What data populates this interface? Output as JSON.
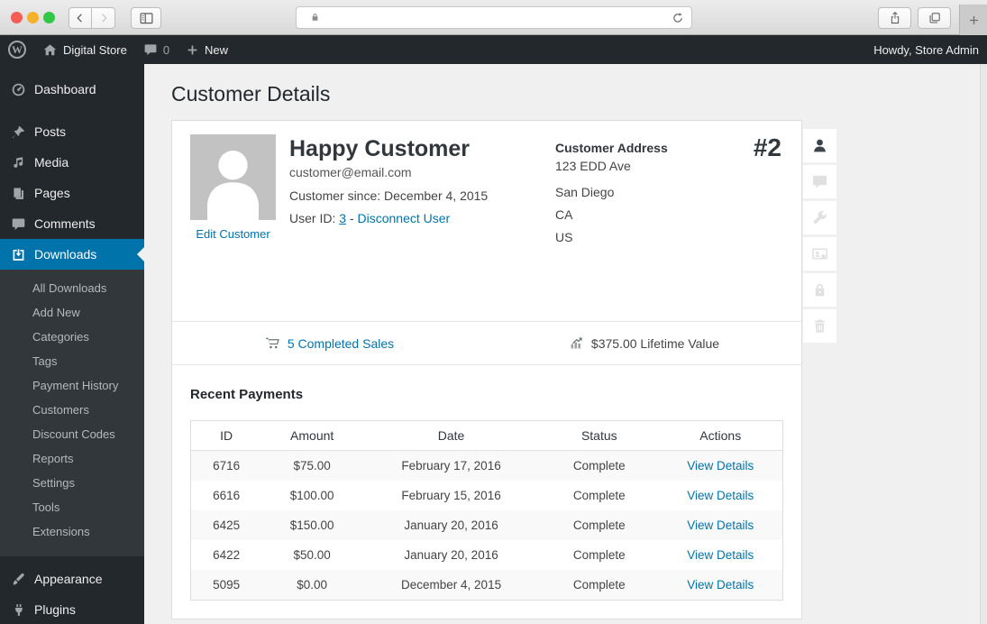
{
  "browser": {
    "url": "",
    "icons": [
      "close-button",
      "minimize-button",
      "zoom-button",
      "back-icon",
      "forward-icon",
      "sidebar-toggle-icon",
      "lock-icon",
      "reload-icon",
      "share-icon",
      "tab-overview-icon",
      "new-tab-icon"
    ]
  },
  "admin_bar": {
    "site_name": "Digital Store",
    "comment_count": "0",
    "new_label": "New",
    "howdy": "Howdy, Store Admin",
    "icons": [
      "wordpress-logo-icon",
      "home-icon",
      "comment-icon",
      "plus-icon"
    ]
  },
  "sidebar": {
    "items": [
      {
        "label": "Dashboard",
        "icon": "dashboard-icon"
      },
      {
        "label": "Posts",
        "icon": "pin-icon"
      },
      {
        "label": "Media",
        "icon": "media-icon"
      },
      {
        "label": "Pages",
        "icon": "pages-icon"
      },
      {
        "label": "Comments",
        "icon": "comment-icon"
      },
      {
        "label": "Downloads",
        "icon": "download-icon",
        "active": true
      },
      {
        "label": "Appearance",
        "icon": "brush-icon"
      },
      {
        "label": "Plugins",
        "icon": "plugin-icon"
      }
    ],
    "downloads_submenu": [
      "All Downloads",
      "Add New",
      "Categories",
      "Tags",
      "Payment History",
      "Customers",
      "Discount Codes",
      "Reports",
      "Settings",
      "Tools",
      "Extensions"
    ]
  },
  "page": {
    "title": "Customer Details"
  },
  "customer": {
    "name": "Happy Customer",
    "email": "customer@email.com",
    "since": "Customer since: December 4, 2015",
    "user_id_label": "User ID:",
    "user_id_value": "3",
    "user_id_separator": "-",
    "disconnect_label": "Disconnect User",
    "edit_label": "Edit Customer",
    "number": "#2",
    "address_title": "Customer Address",
    "address_line1": "123 EDD Ave",
    "address_city": "San Diego",
    "address_state": "CA",
    "address_country": "US"
  },
  "stats": {
    "completed_sales": "5 Completed Sales",
    "lifetime_value": "$375.00 Lifetime Value",
    "icons": [
      "cart-icon",
      "chart-icon"
    ]
  },
  "payments": {
    "title": "Recent Payments",
    "columns": [
      "ID",
      "Amount",
      "Date",
      "Status",
      "Actions"
    ],
    "rows": [
      {
        "id": "6716",
        "amount": "$75.00",
        "date": "February 17, 2016",
        "status": "Complete",
        "action": "View Details"
      },
      {
        "id": "6616",
        "amount": "$100.00",
        "date": "February 15, 2016",
        "status": "Complete",
        "action": "View Details"
      },
      {
        "id": "6425",
        "amount": "$150.00",
        "date": "January 20, 2016",
        "status": "Complete",
        "action": "View Details"
      },
      {
        "id": "6422",
        "amount": "$50.00",
        "date": "January 20, 2016",
        "status": "Complete",
        "action": "View Details"
      },
      {
        "id": "5095",
        "amount": "$0.00",
        "date": "December 4, 2015",
        "status": "Complete",
        "action": "View Details"
      }
    ]
  },
  "customer_tabs": [
    "profile",
    "notes",
    "tools",
    "login-as-user",
    "reset-password",
    "delete"
  ],
  "colors": {
    "accent": "#0073aa",
    "admin_bar_bg": "#23282d",
    "submenu_bg": "#32373c",
    "page_bg": "#f0f0f1",
    "panel_border": "#dddddd",
    "row_stripe": "#f9f9f9",
    "traffic_red": "#f35e55",
    "traffic_yellow": "#f5b02e",
    "traffic_green": "#33c748"
  }
}
